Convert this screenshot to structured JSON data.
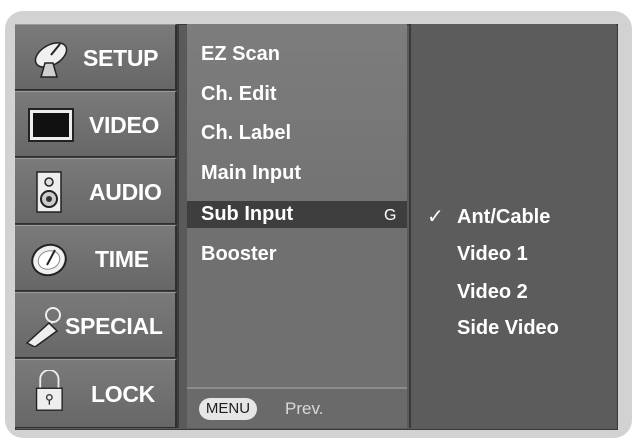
{
  "sidebar": {
    "items": [
      {
        "label": "SETUP",
        "icon": "satellite-dish-icon"
      },
      {
        "label": "VIDEO",
        "icon": "monitor-icon"
      },
      {
        "label": "AUDIO",
        "icon": "speaker-icon"
      },
      {
        "label": "TIME",
        "icon": "clock-icon"
      },
      {
        "label": "SPECIAL",
        "icon": "key-tag-icon"
      },
      {
        "label": "LOCK",
        "icon": "padlock-icon"
      }
    ]
  },
  "menu": {
    "items": [
      {
        "label": "EZ Scan"
      },
      {
        "label": "Ch. Edit"
      },
      {
        "label": "Ch. Label"
      },
      {
        "label": "Main Input"
      },
      {
        "label": "Sub Input",
        "selected": true,
        "arrow": "G"
      },
      {
        "label": "Booster"
      }
    ],
    "footer": {
      "button_label": "MENU",
      "prev_label": "Prev."
    }
  },
  "options": {
    "checkmark": "✓",
    "items": [
      {
        "label": "Ant/Cable",
        "checked": true
      },
      {
        "label": "Video 1"
      },
      {
        "label": "Video 2"
      },
      {
        "label": "Side Video"
      }
    ]
  }
}
